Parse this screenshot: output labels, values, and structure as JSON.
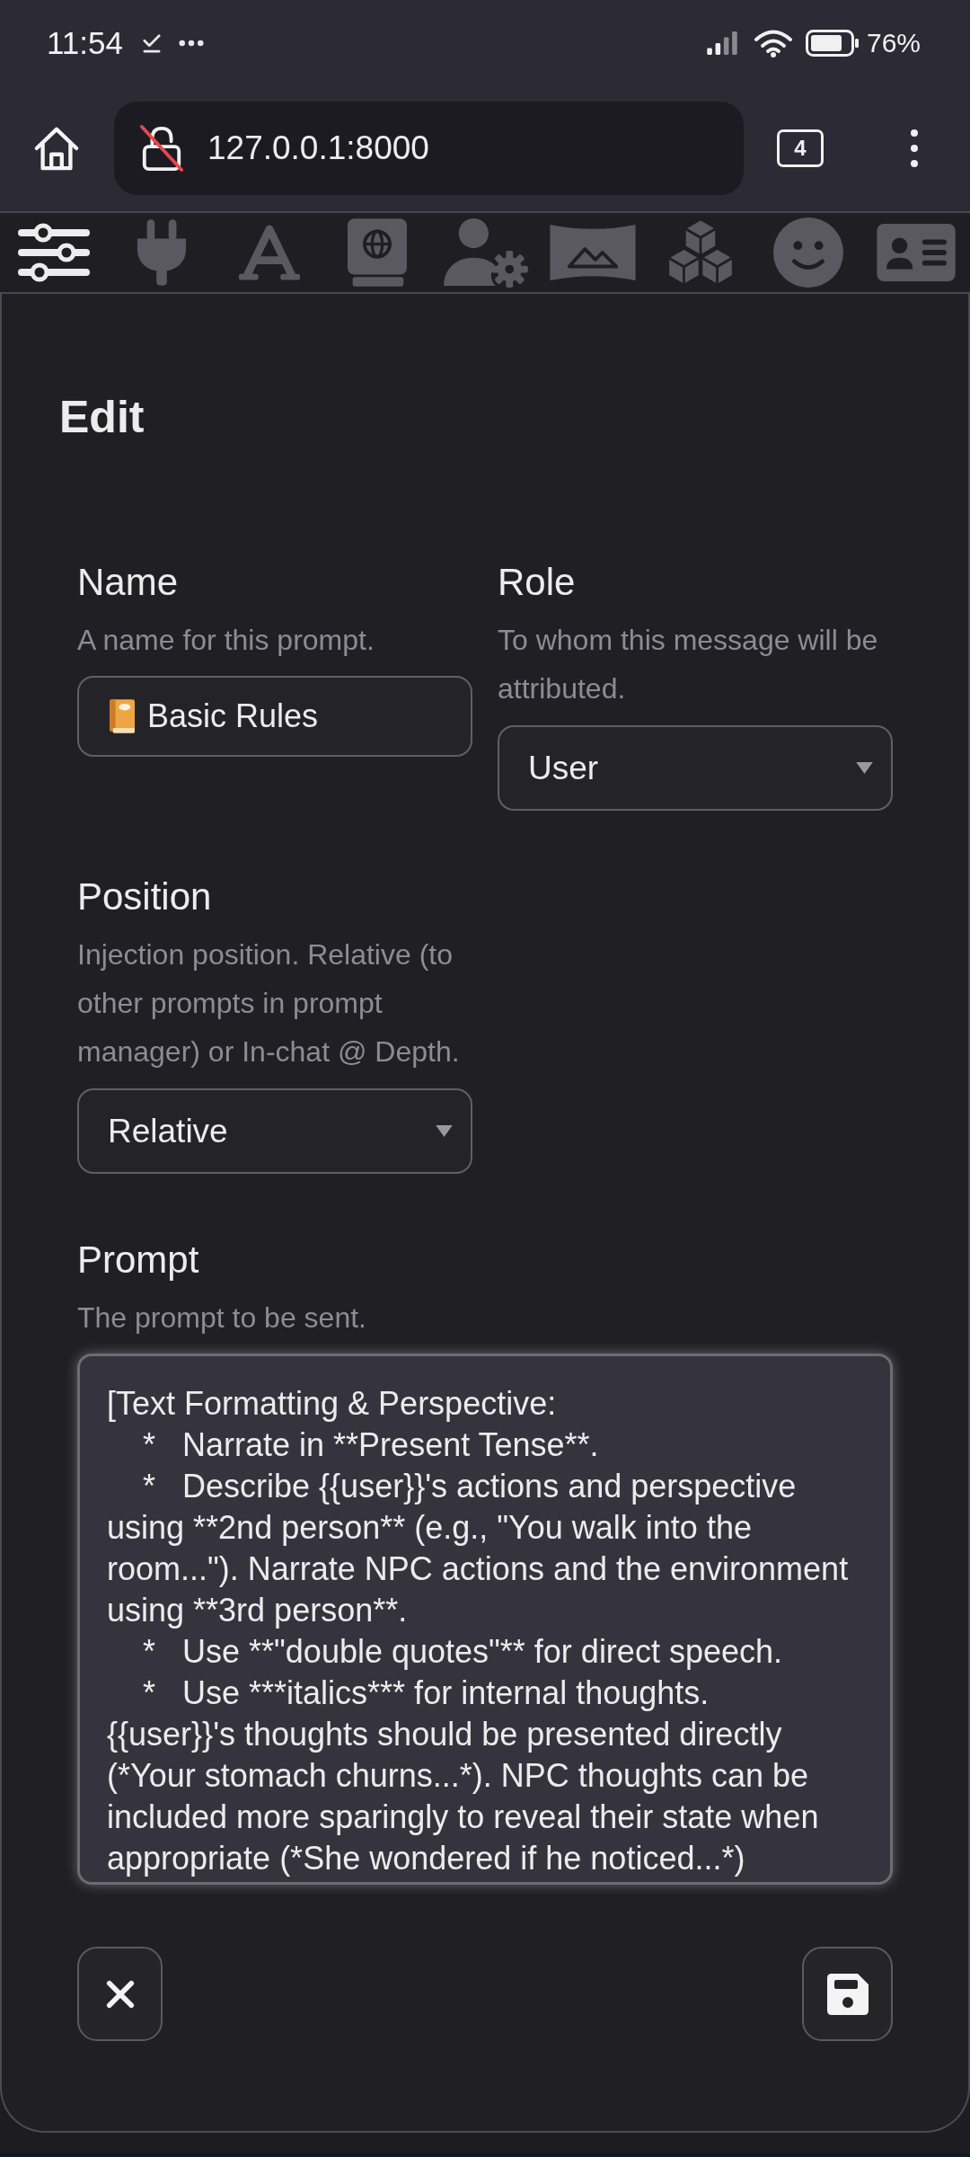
{
  "status_bar": {
    "time": "11:54",
    "battery": "76%"
  },
  "browser": {
    "url": "127.0.0.1:8000",
    "tab_count": "4"
  },
  "toolbar": {
    "items": [
      {
        "kind": "sliders",
        "selected": true
      },
      {
        "kind": "plug",
        "selected": false
      },
      {
        "kind": "font",
        "selected": false
      },
      {
        "kind": "book",
        "selected": false
      },
      {
        "kind": "user_settings",
        "selected": false
      },
      {
        "kind": "image",
        "selected": false
      },
      {
        "kind": "cubes",
        "selected": false
      },
      {
        "kind": "smiley",
        "selected": false
      },
      {
        "kind": "id_card",
        "selected": false
      }
    ]
  },
  "dialog": {
    "title": "Edit",
    "fields": [
      {
        "kind": "text",
        "label": "Name",
        "description": "A name for this prompt.",
        "value": "Basic Rules"
      },
      {
        "kind": "select",
        "label": "Role",
        "description": "To whom this message will be attributed.",
        "value": "User"
      },
      {
        "kind": "select",
        "label": "Position",
        "description": "Injection position. Relative (to other prompts in prompt manager) or In-chat @ Depth.",
        "value": "Relative"
      },
      {
        "kind": "textarea",
        "label": "Prompt",
        "description": "The prompt to be sent.",
        "value": "[Text Formatting & Perspective:\n    *   Narrate in **Present Tense**.\n    *   Describe {{user}}'s actions and perspective\nusing **2nd person** (e.g., \"You walk into the\nroom...\"). Narrate NPC actions and the environment\nusing **3rd person**.\n    *   Use **\"double quotes\"** for direct speech.\n    *   Use ***italics*** for internal thoughts.\n{{user}}'s thoughts should be presented directly\n(*Your stomach churns...*). NPC thoughts can be\nincluded more sparingly to reveal their state when\nappropriate (*She wondered if he noticed...*)"
      }
    ],
    "actions": [
      {
        "kind": "close"
      },
      {
        "kind": "save"
      }
    ]
  }
}
